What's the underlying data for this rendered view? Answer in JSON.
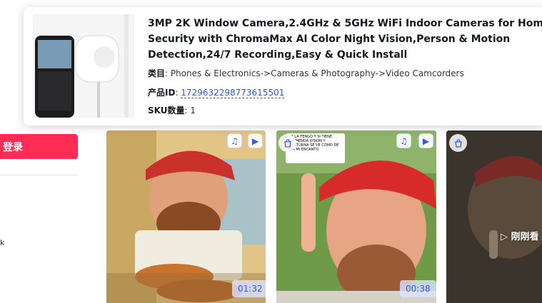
{
  "sidebar": {
    "login_label": "登录",
    "stub_text": "k"
  },
  "product": {
    "title": "3MP 2K Window Camera,2.4GHz & 5GHz WiFi Indoor Cameras for Home Security with ChromaMax AI Color Night Vision,Person & Motion Detection,24/7 Recording,Easy & Quick Install",
    "category_label": "类目",
    "category_value": "Phones & Electronics->Cameras & Photography->Video Camcorders",
    "id_label": "产品ID",
    "id_value": "1729632298773615501",
    "sku_label": "SKU数量",
    "sku_value": "1"
  },
  "videos": [
    {
      "duration": "01:32",
      "icons": [
        "music-icon",
        "video-icon"
      ]
    },
    {
      "duration": "00:38",
      "icons": [
        "cart-icon",
        "music-icon",
        "video-icon"
      ],
      "caption": "YO LA TENGO Y SI TIENE TREMENDA VISION Y NOCTURNA SE VE COMO DE DIA MI ENCANTO"
    },
    {
      "play_label": "▷ 刚刚看",
      "icons": [
        "cart-icon"
      ]
    }
  ],
  "colors": {
    "accent": "#fe2c55",
    "link": "#2b5bd7",
    "chip_text": "#3b5bdb"
  }
}
